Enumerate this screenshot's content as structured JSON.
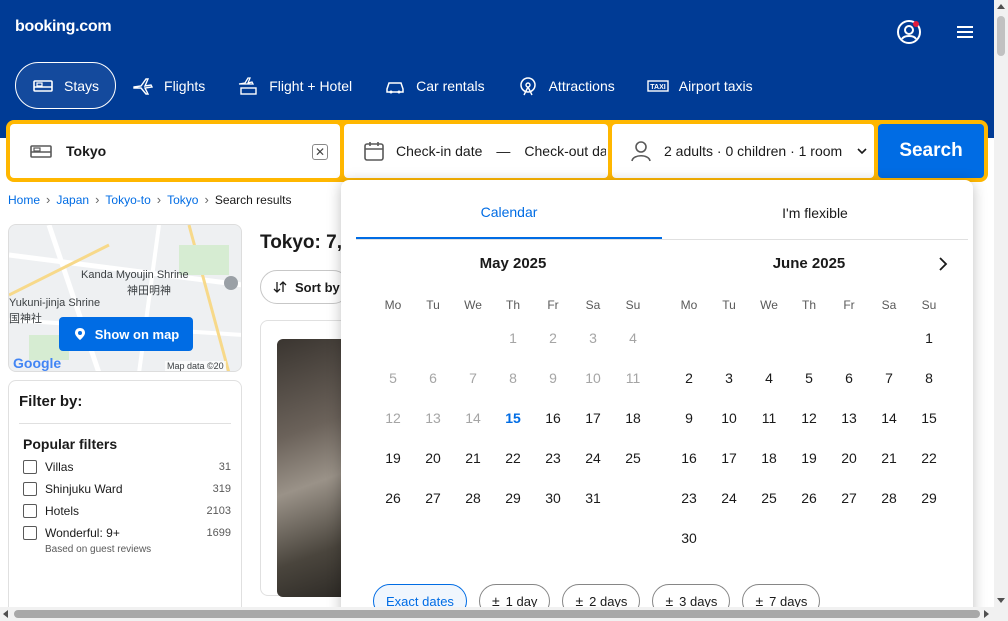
{
  "header": {
    "logo": "booking.com",
    "nav": [
      {
        "label": "Stays",
        "icon": "bed-icon",
        "active": true
      },
      {
        "label": "Flights",
        "icon": "plane-icon"
      },
      {
        "label": "Flight + Hotel",
        "icon": "plane-bed-icon"
      },
      {
        "label": "Car rentals",
        "icon": "car-icon"
      },
      {
        "label": "Attractions",
        "icon": "attractions-icon"
      },
      {
        "label": "Airport taxis",
        "icon": "taxi-icon"
      }
    ]
  },
  "search": {
    "destination": "Tokyo",
    "clear": "✕",
    "checkin": "Check-in date",
    "dash": "—",
    "checkout": "Check-out date",
    "guests": "2 adults · 0 children · 1 room",
    "button": "Search"
  },
  "breadcrumb": {
    "items": [
      "Home",
      "Japan",
      "Tokyo-to",
      "Tokyo"
    ],
    "current": "Search results"
  },
  "map": {
    "labels": [
      "Kanda Myoujin Shrine",
      "神田明神",
      "Yukuni-jinja Shrine",
      "国神社"
    ],
    "button": "Show on map",
    "google": "Google",
    "data": "Map data ©20"
  },
  "filters": {
    "title": "Filter by:",
    "section": "Popular filters",
    "items": [
      {
        "label": "Villas",
        "count": "31"
      },
      {
        "label": "Shinjuku Ward",
        "count": "319"
      },
      {
        "label": "Hotels",
        "count": "2103"
      },
      {
        "label": "Wonderful: 9+",
        "count": "1699",
        "sub": "Based on guest reviews"
      }
    ]
  },
  "results": {
    "title": "Tokyo: 7,",
    "sort": "Sort by"
  },
  "datepicker": {
    "tabs": [
      "Calendar",
      "I'm flexible"
    ],
    "dow": [
      "Mo",
      "Tu",
      "We",
      "Th",
      "Fr",
      "Sa",
      "Su"
    ],
    "months": [
      {
        "title": "May 2025",
        "weeks": [
          [
            "",
            "",
            "",
            "1",
            "2",
            "3",
            "4"
          ],
          [
            "5",
            "6",
            "7",
            "8",
            "9",
            "10",
            "11"
          ],
          [
            "12",
            "13",
            "14",
            "15",
            "16",
            "17",
            "18"
          ],
          [
            "19",
            "20",
            "21",
            "22",
            "23",
            "24",
            "25"
          ],
          [
            "26",
            "27",
            "28",
            "29",
            "30",
            "31",
            ""
          ]
        ]
      },
      {
        "title": "June 2025",
        "weeks": [
          [
            "",
            "",
            "",
            "",
            "",
            "",
            "1"
          ],
          [
            "2",
            "3",
            "4",
            "5",
            "6",
            "7",
            "8"
          ],
          [
            "9",
            "10",
            "11",
            "12",
            "13",
            "14",
            "15"
          ],
          [
            "16",
            "17",
            "18",
            "19",
            "20",
            "21",
            "22"
          ],
          [
            "23",
            "24",
            "25",
            "26",
            "27",
            "28",
            "29"
          ],
          [
            "30",
            "",
            "",
            "",
            "",
            "",
            ""
          ]
        ]
      }
    ],
    "today": "15",
    "flex_options": [
      "Exact dates",
      "1 day",
      "2 days",
      "3 days",
      "7 days"
    ]
  },
  "colors": {
    "brand": "#003b95",
    "accent": "#006ce4",
    "search_border": "#ffb700"
  }
}
